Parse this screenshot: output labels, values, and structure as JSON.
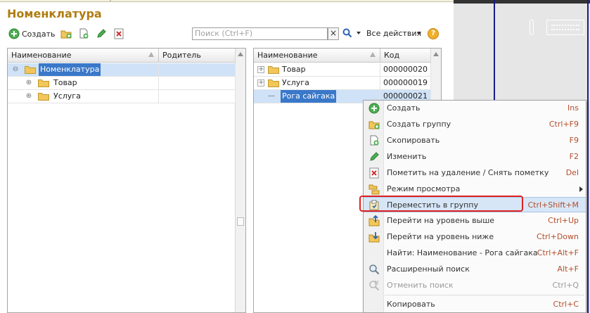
{
  "page": {
    "title": "Номенклатура"
  },
  "toolbar": {
    "create_label": "Создать",
    "search_placeholder": "Поиск (Ctrl+F)",
    "clear_glyph": "×",
    "all_actions_label": "Все действия",
    "help_glyph": "?"
  },
  "left_tree": {
    "col_name": "Наименование",
    "col_parent": "Родитель",
    "rows": [
      {
        "label": "Номенклатура",
        "parent": "",
        "expander": "⊖",
        "selected": true
      },
      {
        "label": "Товар",
        "parent": "",
        "expander": "⊕"
      },
      {
        "label": "Услуга",
        "parent": "",
        "expander": "⊕"
      }
    ]
  },
  "right_list": {
    "col_name": "Наименование",
    "col_code": "Код",
    "rows": [
      {
        "label": "Товар",
        "code": "000000020",
        "expander": "+"
      },
      {
        "label": "Услуга",
        "code": "000000019",
        "expander": "+"
      },
      {
        "label": "Рога сайгака",
        "code": "000000021",
        "expander": "—"
      }
    ]
  },
  "context_menu": {
    "items": [
      {
        "label": "Создать",
        "shortcut": "Ins",
        "icon": "create-icon"
      },
      {
        "label": "Создать группу",
        "shortcut": "Ctrl+F9",
        "icon": "create-group-icon"
      },
      {
        "label": "Скопировать",
        "shortcut": "F9",
        "icon": "copy-icon"
      },
      {
        "label": "Изменить",
        "shortcut": "F2",
        "icon": "edit-icon"
      },
      {
        "label": "Пометить на удаление / Снять пометку",
        "shortcut": "Del",
        "icon": "delete-mark-icon"
      },
      {
        "label": "Режим просмотра",
        "shortcut": "",
        "icon": "view-mode-icon"
      },
      {
        "label": "Переместить в группу",
        "shortcut": "Ctrl+Shift+M",
        "icon": "move-to-group-icon"
      },
      {
        "label": "Перейти на уровень выше",
        "shortcut": "Ctrl+Up",
        "icon": "level-up-icon"
      },
      {
        "label": "Перейти на уровень ниже",
        "shortcut": "Ctrl+Down",
        "icon": "level-down-icon"
      },
      {
        "label": "Найти: Наименование - Рога сайгака",
        "shortcut": "Ctrl+Alt+F",
        "icon": ""
      },
      {
        "label": "Расширенный поиск",
        "shortcut": "Alt+F",
        "icon": "advanced-search-icon"
      },
      {
        "label": "Отменить поиск",
        "shortcut": "Ctrl+Q",
        "icon": "cancel-search-icon"
      },
      {
        "label": "Копировать",
        "shortcut": "Ctrl+C",
        "icon": ""
      }
    ]
  },
  "colors": {
    "title": "#b07c10",
    "selection": "#3a78c9",
    "row_selected": "#cfe2f7",
    "menu_highlight": "#d6e6f7",
    "highlight_frame": "#e02020",
    "shortcut": "#b44d2b"
  }
}
